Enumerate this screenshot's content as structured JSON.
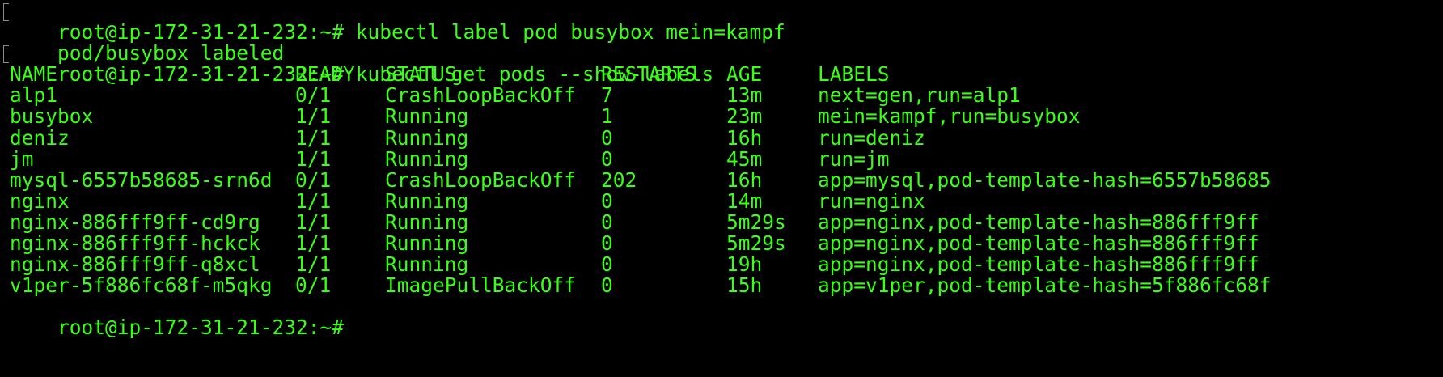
{
  "terminal": {
    "prompt": "root@ip-172-31-21-232:~#",
    "commands": [
      "kubectl label pod busybox mein=kampf",
      "kubectl get pods --show-labels"
    ],
    "outputs": {
      "label_result": "pod/busybox labeled"
    },
    "table": {
      "headers": [
        "NAME",
        "READY",
        "STATUS",
        "RESTARTS",
        "AGE",
        "LABELS"
      ],
      "rows": [
        [
          "alp1",
          "0/1",
          "CrashLoopBackOff",
          "7",
          "13m",
          "next=gen,run=alp1"
        ],
        [
          "busybox",
          "1/1",
          "Running",
          "1",
          "23m",
          "mein=kampf,run=busybox"
        ],
        [
          "deniz",
          "1/1",
          "Running",
          "0",
          "16h",
          "run=deniz"
        ],
        [
          "jm",
          "1/1",
          "Running",
          "0",
          "45m",
          "run=jm"
        ],
        [
          "mysql-6557b58685-srn6d",
          "0/1",
          "CrashLoopBackOff",
          "202",
          "16h",
          "app=mysql,pod-template-hash=6557b58685"
        ],
        [
          "nginx",
          "1/1",
          "Running",
          "0",
          "14m",
          "run=nginx"
        ],
        [
          "nginx-886fff9ff-cd9rg",
          "1/1",
          "Running",
          "0",
          "5m29s",
          "app=nginx,pod-template-hash=886fff9ff"
        ],
        [
          "nginx-886fff9ff-hckck",
          "1/1",
          "Running",
          "0",
          "5m29s",
          "app=nginx,pod-template-hash=886fff9ff"
        ],
        [
          "nginx-886fff9ff-q8xcl",
          "1/1",
          "Running",
          "0",
          "19h",
          "app=nginx,pod-template-hash=886fff9ff"
        ],
        [
          "v1per-5f886fc68f-m5qkg",
          "0/1",
          "ImagePullBackOff",
          "0",
          "15h",
          "app=v1per,pod-template-hash=5f886fc68f"
        ]
      ]
    },
    "colors": {
      "background": "#000000",
      "text": "#39ff14"
    }
  }
}
